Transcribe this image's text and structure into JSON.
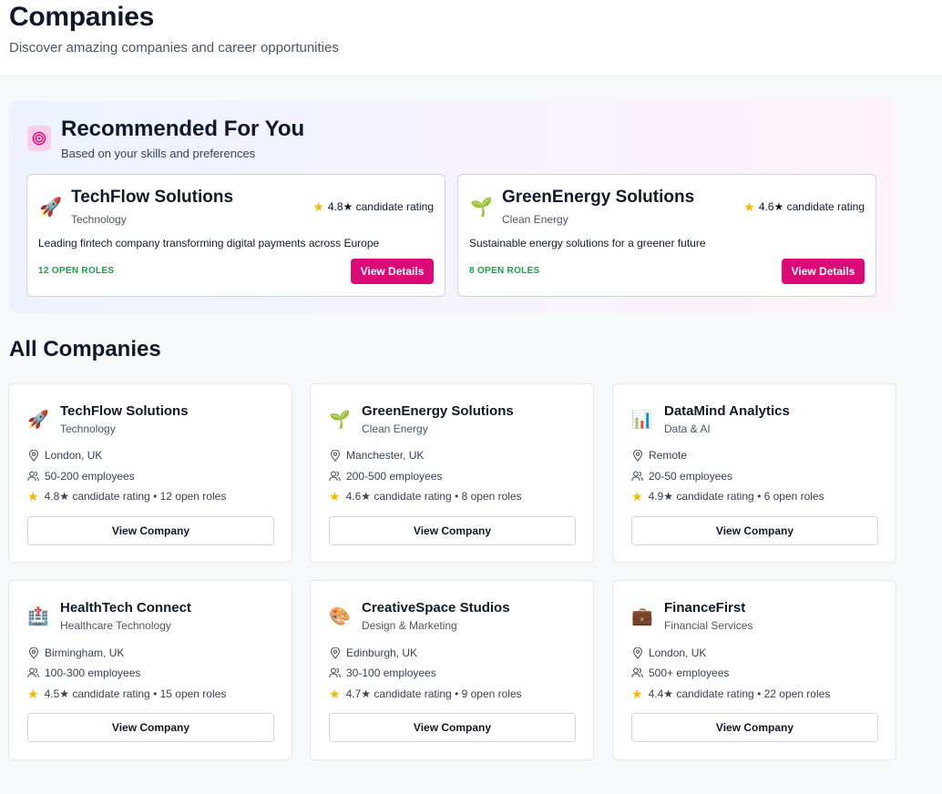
{
  "header": {
    "title": "Companies",
    "subtitle": "Discover amazing companies and career opportunities"
  },
  "recommended": {
    "icon": "target-icon",
    "title": "Recommended For You",
    "subtitle": "Based on your skills and preferences",
    "cards": [
      {
        "icon": "🚀",
        "name": "TechFlow Solutions",
        "industry": "Technology",
        "rating": "4.8★ candidate rating",
        "description": "Leading fintech company transforming digital payments across Europe",
        "open_roles": "12 OPEN ROLES",
        "button": "View Details"
      },
      {
        "icon": "🌱",
        "name": "GreenEnergy Solutions",
        "industry": "Clean Energy",
        "rating": "4.6★ candidate rating",
        "description": "Sustainable energy solutions for a greener future",
        "open_roles": "8 OPEN ROLES",
        "button": "View Details"
      }
    ]
  },
  "all_companies": {
    "title": "All Companies",
    "button_label": "View Company",
    "companies": [
      {
        "icon": "🚀",
        "name": "TechFlow Solutions",
        "industry": "Technology",
        "location": "London, UK",
        "employees": "50-200 employees",
        "rating": "4.8★ candidate rating • 12 open roles"
      },
      {
        "icon": "🌱",
        "name": "GreenEnergy Solutions",
        "industry": "Clean Energy",
        "location": "Manchester, UK",
        "employees": "200-500 employees",
        "rating": "4.6★ candidate rating • 8 open roles"
      },
      {
        "icon": "📊",
        "name": "DataMind Analytics",
        "industry": "Data & AI",
        "location": "Remote",
        "employees": "20-50 employees",
        "rating": "4.9★ candidate rating • 6 open roles"
      },
      {
        "icon": "🏥",
        "name": "HealthTech Connect",
        "industry": "Healthcare Technology",
        "location": "Birmingham, UK",
        "employees": "100-300 employees",
        "rating": "4.5★ candidate rating • 15 open roles"
      },
      {
        "icon": "🎨",
        "name": "CreativeSpace Studios",
        "industry": "Design & Marketing",
        "location": "Edinburgh, UK",
        "employees": "30-100 employees",
        "rating": "4.7★ candidate rating • 9 open roles"
      },
      {
        "icon": "💼",
        "name": "FinanceFirst",
        "industry": "Financial Services",
        "location": "London, UK",
        "employees": "500+ employees",
        "rating": "4.4★ candidate rating • 22 open roles"
      }
    ]
  },
  "colors": {
    "accent": "#db0a76",
    "open_roles": "#16a34a",
    "star": "#f5b800"
  }
}
